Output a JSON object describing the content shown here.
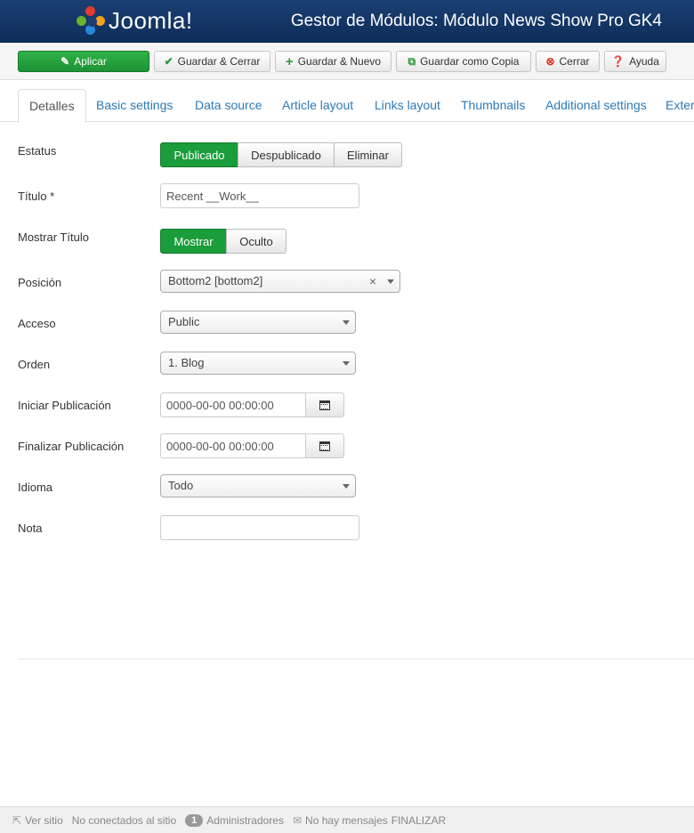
{
  "header": {
    "logo_text": "Joomla!",
    "page_title": "Gestor de Módulos: Módulo News Show Pro GK4"
  },
  "toolbar": {
    "apply": "Aplicar",
    "save_close": "Guardar & Cerrar",
    "save_new": "Guardar & Nuevo",
    "save_copy": "Guardar como Copia",
    "close": "Cerrar",
    "help": "Ayuda"
  },
  "tabs": [
    "Detalles",
    "Basic settings",
    "Data source",
    "Article layout",
    "Links layout",
    "Thumbnails",
    "Additional settings",
    "Exter"
  ],
  "form": {
    "status": {
      "label": "Estatus",
      "options": [
        "Publicado",
        "Despublicado",
        "Eliminar"
      ],
      "selected": "Publicado"
    },
    "title": {
      "label": "Título *",
      "value": "Recent __Work__"
    },
    "show_title": {
      "label": "Mostrar Título",
      "options": [
        "Mostrar",
        "Oculto"
      ],
      "selected": "Mostrar"
    },
    "position": {
      "label": "Posición",
      "value": "Bottom2 [bottom2]",
      "clear": "×"
    },
    "access": {
      "label": "Acceso",
      "value": "Public"
    },
    "order": {
      "label": "Orden",
      "value": "1. Blog"
    },
    "publish_up": {
      "label": "Iniciar Publicación",
      "value": "0000-00-00 00:00:00"
    },
    "publish_down": {
      "label": "Finalizar Publicación",
      "value": "0000-00-00 00:00:00"
    },
    "language": {
      "label": "Idioma",
      "value": "Todo"
    },
    "note": {
      "label": "Nota",
      "value": ""
    }
  },
  "statusbar": {
    "view_site": "Ver sitio",
    "not_connected": "No conectados al sitio",
    "admins_count": "1",
    "admins": "Administradores",
    "messages": "No hay mensajes",
    "logout": "FINALIZAR"
  },
  "colors": {
    "header": "#153a6b",
    "primary_green": "#1a9d3a",
    "link_blue": "#2a7ab8"
  }
}
